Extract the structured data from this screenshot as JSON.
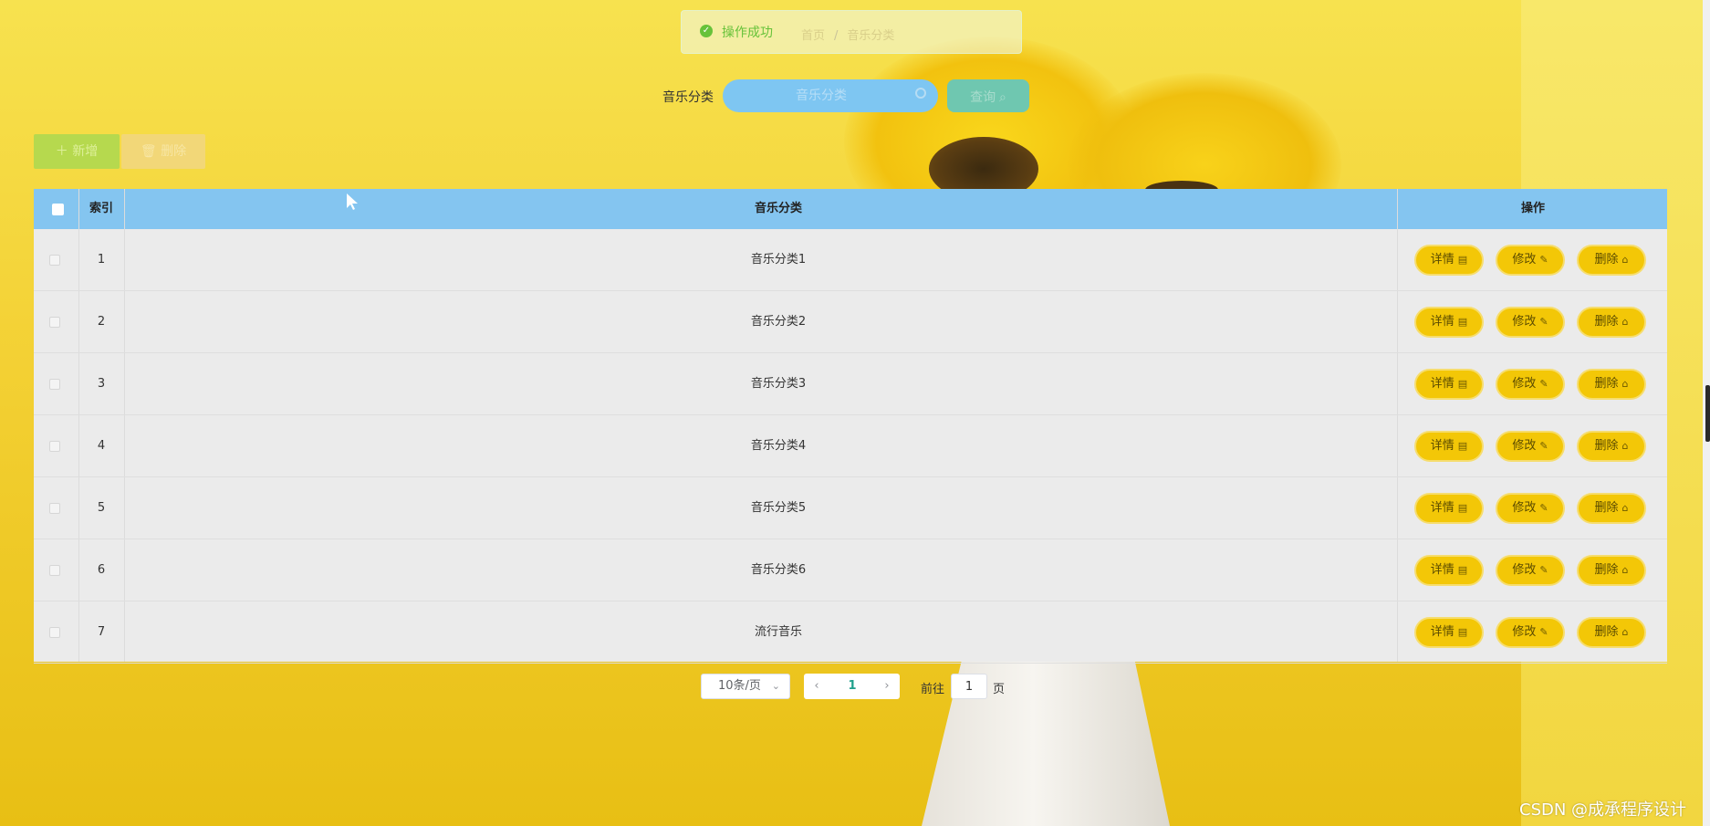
{
  "toast": {
    "message": "操作成功"
  },
  "breadcrumb": {
    "home": "首页",
    "separator": "/",
    "current": "音乐分类"
  },
  "search": {
    "label": "音乐分类",
    "placeholder": "音乐分类",
    "button_label": "查询"
  },
  "toolbar": {
    "add_label": "新增",
    "delete_label": "删除"
  },
  "table": {
    "headers": {
      "index": "索引",
      "category": "音乐分类",
      "actions": "操作"
    },
    "rows": [
      {
        "index": "1",
        "category": "音乐分类1"
      },
      {
        "index": "2",
        "category": "音乐分类2"
      },
      {
        "index": "3",
        "category": "音乐分类3"
      },
      {
        "index": "4",
        "category": "音乐分类4"
      },
      {
        "index": "5",
        "category": "音乐分类5"
      },
      {
        "index": "6",
        "category": "音乐分类6"
      },
      {
        "index": "7",
        "category": "流行音乐"
      }
    ],
    "row_actions": {
      "detail": "详情",
      "edit": "修改",
      "delete": "删除"
    }
  },
  "pagination": {
    "page_size": "10条/页",
    "current_page": "1",
    "goto_label": "前往",
    "goto_value": "1",
    "goto_suffix": "页"
  },
  "watermark": "CSDN @成承程序设计",
  "icons": {
    "toast": "check-circle-icon",
    "search": "search-icon",
    "add": "plus-icon",
    "delete": "trash-icon",
    "detail": "document-icon",
    "edit": "pencil-icon",
    "prev": "chevron-left-icon",
    "next": "chevron-right-icon",
    "dropdown": "chevron-down-icon"
  },
  "colors": {
    "table_header": "#84c5f0",
    "action_button": "#f3c707",
    "search_input": "#7ec6f2",
    "query_button": "#6fc7b0",
    "add_button": "#b6d94e",
    "delete_button": "#f2d778",
    "success": "#67c23a",
    "active_page": "#21a08c"
  }
}
